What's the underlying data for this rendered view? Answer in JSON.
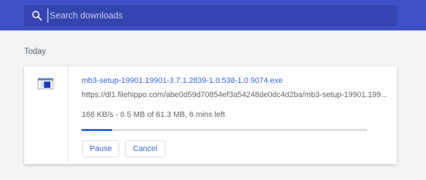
{
  "search": {
    "placeholder": "Search downloads",
    "value": ""
  },
  "section": {
    "title": "Today"
  },
  "download": {
    "file_name": "mb3-setup-19901.19901-3.7.1.2839-1.0.538-1.0.9074.exe",
    "url": "https://dl1.filehippo.com/abe0d59d70854ef3a54248de0dc4d2ba/mb3-setup-19901.199...",
    "status": "168 KB/s - 6.5 MB of 61.3 MB, 6 mins left",
    "progress_fraction": 0.106,
    "pause_label": "Pause",
    "cancel_label": "Cancel",
    "icon": "windows-executable-icon"
  },
  "colors": {
    "header": "#3f51c5",
    "search_box": "#3544b0",
    "accent": "#3367d6",
    "background": "#f1f3f4"
  }
}
